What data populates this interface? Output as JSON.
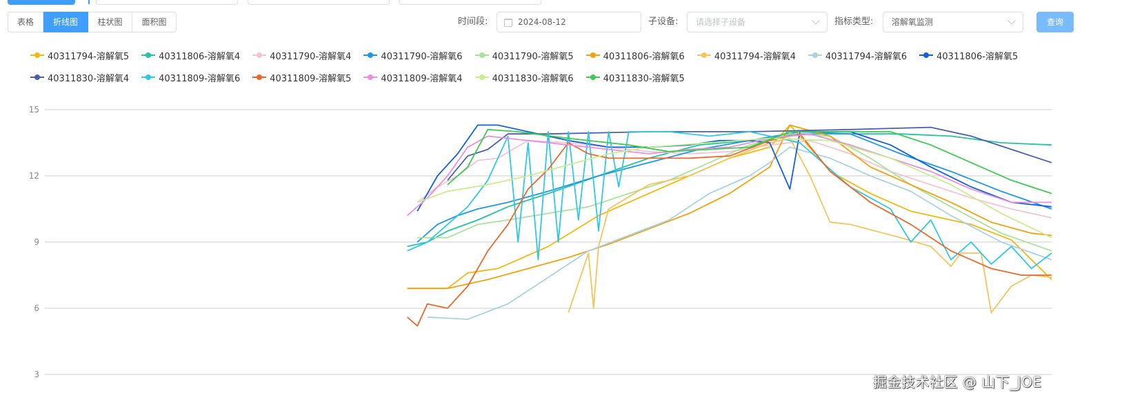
{
  "toolbar": {
    "view_tabs": [
      {
        "label": "表格",
        "active": false
      },
      {
        "label": "折线图",
        "active": true
      },
      {
        "label": "柱状图",
        "active": false
      },
      {
        "label": "面积图",
        "active": false
      }
    ],
    "period_label": "时间段:",
    "date_value": "2024-08-12",
    "device_label": "子设备:",
    "device_placeholder": "请选择子设备",
    "metric_label": "指标类型:",
    "metric_value": "溶解氧监测",
    "query_label": "查询"
  },
  "colors": {
    "primary": "#409eff",
    "primary_light": "#79bbff",
    "grid": "#cccccc",
    "axis_text": "#888888"
  },
  "watermark": "掘金技术社区 @ 山下_JOE",
  "chart_data": {
    "type": "line",
    "title": "",
    "xlabel": "",
    "ylabel": "",
    "ylim": [
      3,
      15
    ],
    "y_ticks": [
      3,
      6,
      9,
      12,
      15
    ],
    "x_range": [
      0,
      100
    ],
    "grid": true,
    "legend_position": "top",
    "series": [
      {
        "name": "40311794-溶解氧5",
        "color": "#f2b80f",
        "points": [
          [
            36,
            6.9
          ],
          [
            40,
            6.9
          ],
          [
            42,
            7.6
          ],
          [
            45,
            7.8
          ],
          [
            50,
            8.8
          ],
          [
            55,
            10.2
          ],
          [
            60,
            11.2
          ],
          [
            64,
            12.0
          ],
          [
            68,
            12.8
          ],
          [
            72,
            13.3
          ],
          [
            74,
            14.3
          ],
          [
            75,
            13.8
          ],
          [
            78,
            12.2
          ],
          [
            82,
            11.2
          ],
          [
            86,
            10.4
          ],
          [
            92,
            9.8
          ],
          [
            96,
            9.1
          ],
          [
            100,
            7.3
          ]
        ]
      },
      {
        "name": "40311806-溶解氧4",
        "color": "#23c4a1",
        "points": [
          [
            36,
            8.8
          ],
          [
            38,
            9.0
          ],
          [
            40,
            9.5
          ],
          [
            43,
            10.0
          ],
          [
            46,
            10.6
          ],
          [
            50,
            11.2
          ],
          [
            55,
            12.0
          ],
          [
            60,
            12.8
          ],
          [
            65,
            13.4
          ],
          [
            70,
            13.6
          ],
          [
            75,
            13.9
          ],
          [
            80,
            13.9
          ],
          [
            85,
            13.9
          ],
          [
            90,
            13.8
          ],
          [
            95,
            13.5
          ],
          [
            100,
            13.4
          ]
        ]
      },
      {
        "name": "40311790-溶解氧4",
        "color": "#f4c3d0",
        "points": [
          [
            37,
            10.8
          ],
          [
            39,
            11.5
          ],
          [
            41,
            12.0
          ],
          [
            43,
            12.7
          ],
          [
            45,
            12.8
          ],
          [
            48,
            13.6
          ],
          [
            52,
            13.5
          ],
          [
            56,
            13.3
          ],
          [
            60,
            13.1
          ],
          [
            64,
            13.0
          ],
          [
            68,
            13.1
          ],
          [
            72,
            13.4
          ],
          [
            76,
            13.6
          ],
          [
            80,
            13.0
          ],
          [
            84,
            12.2
          ],
          [
            88,
            11.6
          ],
          [
            92,
            11.0
          ],
          [
            96,
            10.5
          ],
          [
            100,
            10.1
          ]
        ]
      },
      {
        "name": "40311790-溶解氧6",
        "color": "#1e97e6",
        "points": [
          [
            37,
            9.0
          ],
          [
            39,
            9.8
          ],
          [
            41,
            10.2
          ],
          [
            43,
            10.5
          ],
          [
            46,
            10.8
          ],
          [
            50,
            11.3
          ],
          [
            55,
            12.0
          ],
          [
            60,
            12.6
          ],
          [
            65,
            13.2
          ],
          [
            70,
            13.6
          ],
          [
            75,
            14.0
          ],
          [
            80,
            13.9
          ],
          [
            85,
            13.0
          ],
          [
            90,
            12.2
          ],
          [
            95,
            11.3
          ],
          [
            100,
            10.5
          ]
        ]
      },
      {
        "name": "40311790-溶解氧5",
        "color": "#a8e29a",
        "points": [
          [
            37,
            9.2
          ],
          [
            40,
            9.2
          ],
          [
            43,
            9.8
          ],
          [
            46,
            10.0
          ],
          [
            50,
            10.3
          ],
          [
            54,
            10.6
          ],
          [
            58,
            11.2
          ],
          [
            62,
            11.8
          ],
          [
            66,
            12.6
          ],
          [
            70,
            13.4
          ],
          [
            74,
            13.9
          ],
          [
            78,
            13.8
          ],
          [
            82,
            12.8
          ],
          [
            86,
            11.6
          ],
          [
            90,
            10.6
          ],
          [
            95,
            9.4
          ],
          [
            100,
            8.6
          ]
        ]
      },
      {
        "name": "40311806-溶解氧6",
        "color": "#f2a10c",
        "points": [
          [
            36,
            6.9
          ],
          [
            40,
            6.9
          ],
          [
            44,
            7.3
          ],
          [
            48,
            7.8
          ],
          [
            52,
            8.3
          ],
          [
            56,
            8.9
          ],
          [
            60,
            9.6
          ],
          [
            64,
            10.3
          ],
          [
            68,
            11.2
          ],
          [
            72,
            12.4
          ],
          [
            74,
            14.3
          ],
          [
            78,
            13.8
          ],
          [
            82,
            12.4
          ],
          [
            86,
            11.6
          ],
          [
            90,
            10.8
          ],
          [
            94,
            9.9
          ],
          [
            98,
            9.4
          ],
          [
            100,
            9.3
          ]
        ]
      },
      {
        "name": "40311794-溶解氧4",
        "color": "#f5c45a",
        "points": [
          [
            52,
            5.8
          ],
          [
            54,
            8.5
          ],
          [
            54.5,
            6.0
          ],
          [
            55,
            8.8
          ],
          [
            56,
            10.5
          ],
          [
            60,
            11.6
          ],
          [
            64,
            12.0
          ],
          [
            68,
            12.8
          ],
          [
            72,
            13.5
          ],
          [
            74,
            13.7
          ],
          [
            76,
            12.0
          ],
          [
            78,
            9.9
          ],
          [
            80,
            9.8
          ],
          [
            85,
            9.2
          ],
          [
            88,
            8.8
          ],
          [
            90,
            7.9
          ],
          [
            91,
            8.5
          ],
          [
            93,
            8.5
          ],
          [
            94,
            5.8
          ],
          [
            96,
            7.0
          ],
          [
            98,
            7.5
          ],
          [
            100,
            7.4
          ]
        ]
      },
      {
        "name": "40311794-溶解氧6",
        "color": "#a9d2e0",
        "points": [
          [
            38,
            5.6
          ],
          [
            42,
            5.5
          ],
          [
            46,
            6.2
          ],
          [
            50,
            7.4
          ],
          [
            54,
            8.6
          ],
          [
            58,
            9.3
          ],
          [
            62,
            10.0
          ],
          [
            66,
            11.2
          ],
          [
            70,
            12.0
          ],
          [
            72,
            12.6
          ],
          [
            74,
            13.3
          ],
          [
            78,
            12.8
          ],
          [
            82,
            12.0
          ],
          [
            86,
            11.3
          ],
          [
            90,
            10.2
          ],
          [
            95,
            9.0
          ],
          [
            100,
            8.2
          ]
        ]
      },
      {
        "name": "40311806-溶解氧5",
        "color": "#1060d8",
        "points": [
          [
            37,
            10.4
          ],
          [
            39,
            12.0
          ],
          [
            41,
            13.0
          ],
          [
            43,
            14.3
          ],
          [
            45,
            14.3
          ],
          [
            48,
            14.0
          ],
          [
            52,
            13.6
          ],
          [
            56,
            13.3
          ],
          [
            60,
            13.3
          ],
          [
            64,
            13.4
          ],
          [
            67,
            13.6
          ],
          [
            70,
            13.6
          ],
          [
            72,
            13.5
          ],
          [
            74,
            11.4
          ],
          [
            75,
            14.0
          ],
          [
            80,
            14.0
          ],
          [
            84,
            13.4
          ],
          [
            88,
            12.4
          ],
          [
            92,
            11.5
          ],
          [
            96,
            10.8
          ],
          [
            100,
            10.6
          ]
        ]
      },
      {
        "name": "40311830-溶解氧4",
        "color": "#4a5eae",
        "points": [
          [
            40,
            11.8
          ],
          [
            42,
            12.9
          ],
          [
            44,
            13.2
          ],
          [
            46,
            13.9
          ],
          [
            50,
            13.9
          ],
          [
            60,
            14.0
          ],
          [
            70,
            14.0
          ],
          [
            80,
            14.1
          ],
          [
            88,
            14.2
          ],
          [
            92,
            13.8
          ],
          [
            96,
            13.2
          ],
          [
            100,
            12.6
          ]
        ]
      },
      {
        "name": "40311809-溶解氧6",
        "color": "#2ec8e6",
        "points": [
          [
            36,
            8.6
          ],
          [
            38,
            9.0
          ],
          [
            40,
            9.8
          ],
          [
            42,
            10.6
          ],
          [
            44,
            11.8
          ],
          [
            46,
            13.8
          ],
          [
            47,
            9.0
          ],
          [
            48,
            13.5
          ],
          [
            49,
            8.2
          ],
          [
            50,
            14.0
          ],
          [
            51,
            9.0
          ],
          [
            52,
            14.0
          ],
          [
            53,
            10.0
          ],
          [
            54,
            14.0
          ],
          [
            55,
            9.5
          ],
          [
            56,
            14.0
          ],
          [
            57,
            11.5
          ],
          [
            58,
            14.0
          ],
          [
            62,
            14.0
          ],
          [
            66,
            13.8
          ],
          [
            70,
            14.0
          ],
          [
            75,
            13.5
          ],
          [
            80,
            11.5
          ],
          [
            84,
            10.5
          ],
          [
            86,
            9.0
          ],
          [
            88,
            10.0
          ],
          [
            90,
            8.2
          ],
          [
            92,
            9.0
          ],
          [
            94,
            8.0
          ],
          [
            96,
            8.8
          ],
          [
            98,
            7.8
          ],
          [
            100,
            8.5
          ]
        ]
      },
      {
        "name": "40311809-溶解氧5",
        "color": "#e8692a",
        "points": [
          [
            36,
            5.6
          ],
          [
            37,
            5.2
          ],
          [
            38,
            6.2
          ],
          [
            40,
            6.0
          ],
          [
            42,
            7.0
          ],
          [
            44,
            8.6
          ],
          [
            46,
            9.8
          ],
          [
            48,
            11.4
          ],
          [
            50,
            12.3
          ],
          [
            52,
            13.5
          ],
          [
            54,
            13.0
          ],
          [
            56,
            12.8
          ],
          [
            60,
            12.8
          ],
          [
            64,
            12.8
          ],
          [
            68,
            12.9
          ],
          [
            72,
            13.6
          ],
          [
            75,
            13.9
          ],
          [
            78,
            12.2
          ],
          [
            82,
            10.8
          ],
          [
            86,
            9.8
          ],
          [
            90,
            8.6
          ],
          [
            94,
            7.8
          ],
          [
            97,
            7.5
          ],
          [
            100,
            7.5
          ]
        ]
      },
      {
        "name": "40311809-溶解氧4",
        "color": "#e98ee2",
        "points": [
          [
            36,
            10.2
          ],
          [
            38,
            11.0
          ],
          [
            40,
            12.0
          ],
          [
            42,
            13.3
          ],
          [
            44,
            13.8
          ],
          [
            48,
            13.6
          ],
          [
            52,
            13.4
          ],
          [
            56,
            13.2
          ],
          [
            60,
            13.0
          ],
          [
            64,
            13.2
          ],
          [
            68,
            13.3
          ],
          [
            72,
            13.7
          ],
          [
            76,
            13.9
          ],
          [
            80,
            13.4
          ],
          [
            84,
            12.8
          ],
          [
            88,
            12.2
          ],
          [
            92,
            11.4
          ],
          [
            96,
            10.8
          ],
          [
            100,
            10.8
          ]
        ]
      },
      {
        "name": "40311830-溶解氧6",
        "color": "#c9ed8e",
        "points": [
          [
            37,
            10.8
          ],
          [
            40,
            11.3
          ],
          [
            44,
            11.6
          ],
          [
            48,
            12.0
          ],
          [
            52,
            12.5
          ],
          [
            56,
            13.0
          ],
          [
            60,
            13.3
          ],
          [
            66,
            13.5
          ],
          [
            72,
            13.7
          ],
          [
            78,
            13.6
          ],
          [
            84,
            12.8
          ],
          [
            90,
            11.6
          ],
          [
            95,
            10.3
          ],
          [
            100,
            9.2
          ]
        ]
      },
      {
        "name": "40311830-溶解氧5",
        "color": "#3bcc50",
        "points": [
          [
            40,
            11.6
          ],
          [
            42,
            12.4
          ],
          [
            44,
            14.1
          ],
          [
            47,
            14.0
          ],
          [
            52,
            13.7
          ],
          [
            58,
            13.4
          ],
          [
            62,
            13.1
          ],
          [
            66,
            13.2
          ],
          [
            70,
            13.3
          ],
          [
            74,
            14.0
          ],
          [
            78,
            14.0
          ],
          [
            84,
            14.0
          ],
          [
            88,
            13.4
          ],
          [
            92,
            12.6
          ],
          [
            96,
            11.8
          ],
          [
            100,
            11.2
          ]
        ]
      }
    ]
  }
}
